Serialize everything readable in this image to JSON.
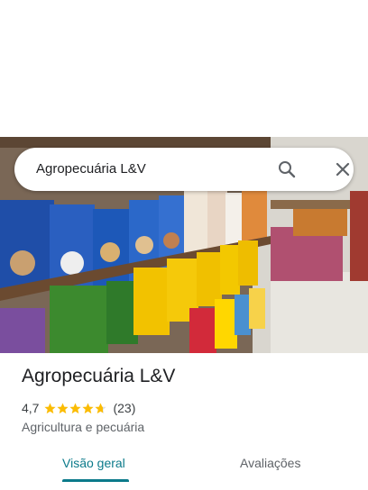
{
  "search": {
    "query": "Agropecuária L&V"
  },
  "icons": {
    "search": "search-icon",
    "close": "close-icon"
  },
  "place": {
    "name": "Agropecuária L&V",
    "rating": "4,7",
    "stars": 4.7,
    "review_count": "(23)",
    "category": "Agricultura e pecuária"
  },
  "tabs": [
    {
      "label": "Visão geral",
      "selected": true
    },
    {
      "label": "Avaliações",
      "selected": false
    }
  ],
  "colors": {
    "accent": "#0b7a8a",
    "star": "#fbbc04"
  }
}
